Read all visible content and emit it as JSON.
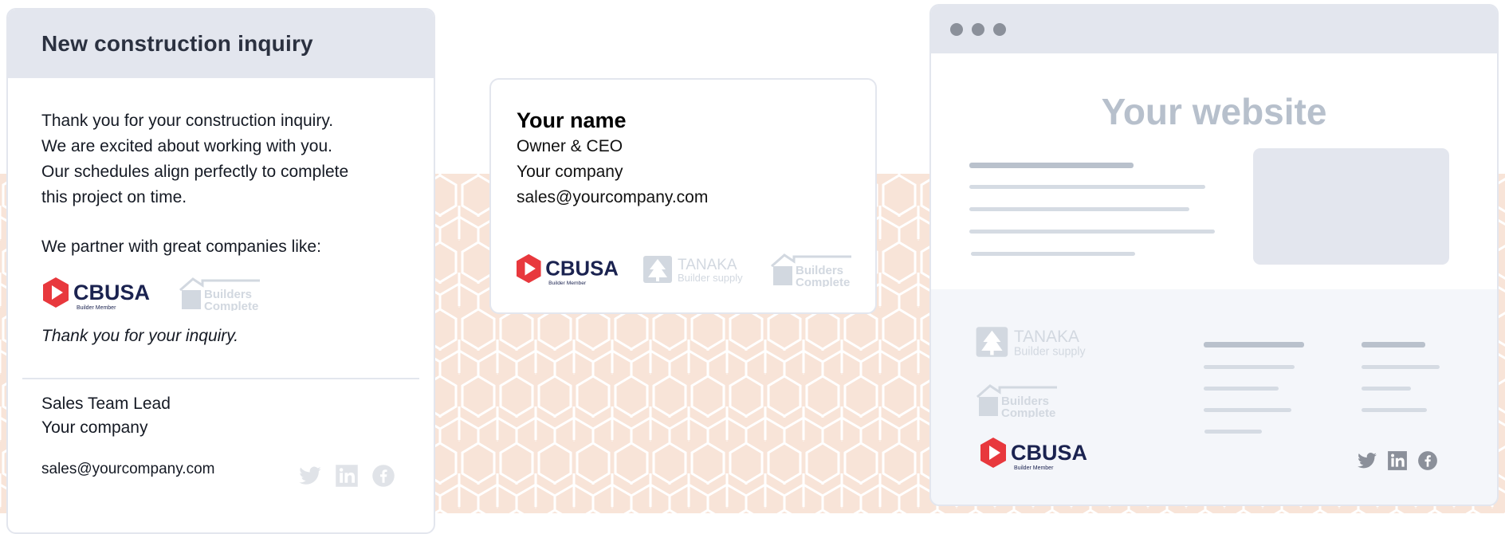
{
  "email": {
    "subject": "New construction inquiry",
    "paragraph_lines": [
      "Thank you for your construction inquiry.",
      "We are excited about working with you.",
      "Our schedules align perfectly to complete",
      "this project on time."
    ],
    "partner_intro": "We partner with great companies like:",
    "thanks": "Thank you for your inquiry.",
    "sender_role": "Sales Team Lead",
    "sender_company": "Your company",
    "sender_email": "sales@yourcompany.com",
    "socials": [
      "twitter-icon",
      "linkedin-icon",
      "facebook-icon"
    ]
  },
  "signature": {
    "name": "Your name",
    "title": "Owner & CEO",
    "company": "Your company",
    "email": "sales@yourcompany.com"
  },
  "website": {
    "title": "Your website",
    "socials": [
      "twitter-icon",
      "linkedin-icon",
      "facebook-icon"
    ]
  },
  "logos": {
    "cbusa": {
      "name": "CBUSA",
      "sub": "Builder Member",
      "colors": {
        "red": "#e8383d",
        "navy": "#1b2350"
      }
    },
    "tanaka": {
      "name": "TANAKA",
      "sub": "Builder supply"
    },
    "builders": {
      "line1": "Builders",
      "line2": "Complete"
    }
  },
  "colors": {
    "header_bg": "#e3e6ee",
    "honeycomb_bg": "#f8e4d8",
    "muted_logo": "#c9d0d9",
    "social_muted": "#e0e3e8",
    "social_dark": "#8b909a"
  }
}
